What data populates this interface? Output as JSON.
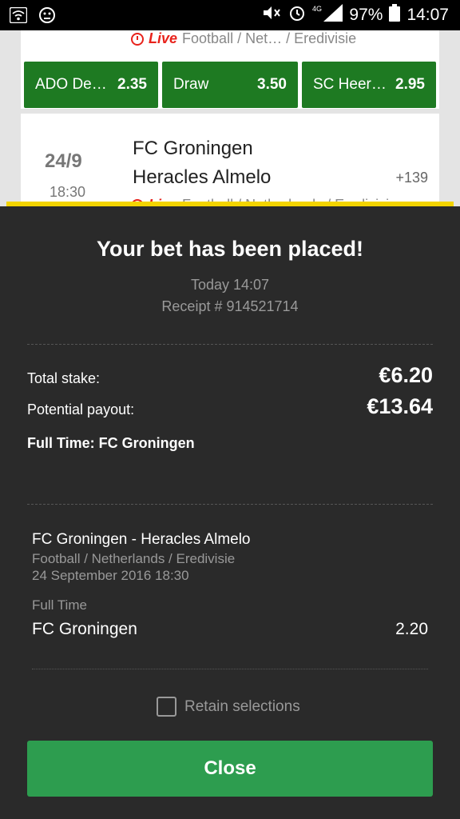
{
  "status_bar": {
    "battery_percent": "97%",
    "network": "4G",
    "time": "14:07"
  },
  "background": {
    "live_label": "Live",
    "breadcrumb_1": "Football / Net… / Eredivisie",
    "odds": [
      {
        "label": "ADO De…",
        "value": "2.35"
      },
      {
        "label": "Draw",
        "value": "3.50"
      },
      {
        "label": "SC Heer…",
        "value": "2.95"
      }
    ],
    "match": {
      "date": "24/9",
      "time": "18:30",
      "home": "FC Groningen",
      "away": "Heracles Almelo",
      "more_markets": "+139"
    },
    "breadcrumb_2": "Football / Netherlands / Eredivisie"
  },
  "modal": {
    "title": "Your bet has been placed!",
    "date": "Today 14:07",
    "receipt": "Receipt # 914521714",
    "total_stake_label": "Total stake:",
    "total_stake_value": "€6.20",
    "payout_label": "Potential payout:",
    "payout_value": "€13.64",
    "outcome": "Full Time: FC Groningen",
    "event": {
      "name": "FC Groningen - Heracles Almelo",
      "league": "Football / Netherlands / Eredivisie",
      "datetime": "24 September 2016 18:30",
      "market": "Full Time",
      "selection": "FC Groningen",
      "odds": "2.20"
    },
    "retain_label": "Retain selections",
    "retain_checked": false,
    "close_label": "Close"
  },
  "colors": {
    "accent_yellow": "#f3d400",
    "odds_green": "#1e7a22",
    "close_green": "#2d9d4f",
    "live_red": "#e8221b",
    "modal_bg": "#2a2a2a"
  }
}
